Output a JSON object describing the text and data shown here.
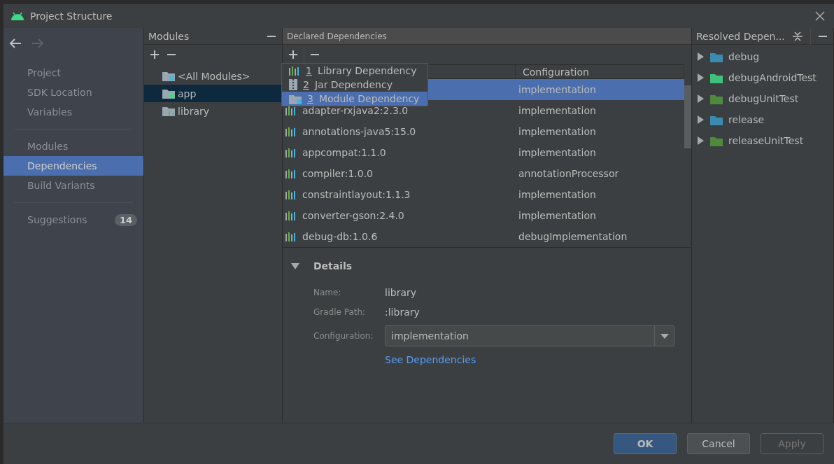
{
  "window": {
    "title": "Project Structure"
  },
  "nav": {
    "back": {
      "disabled": false
    },
    "forward": {
      "disabled": true
    }
  },
  "sidebar": {
    "groups": [
      {
        "items": [
          {
            "label": "Project",
            "selected": false
          },
          {
            "label": "SDK Location",
            "selected": false
          },
          {
            "label": "Variables",
            "selected": false
          }
        ]
      },
      {
        "items": [
          {
            "label": "Modules",
            "selected": false
          },
          {
            "label": "Dependencies",
            "selected": true
          },
          {
            "label": "Build Variants",
            "selected": false
          }
        ]
      },
      {
        "items": [
          {
            "label": "Suggestions",
            "selected": false,
            "badge": "14"
          }
        ]
      }
    ]
  },
  "modules": {
    "title": "Modules",
    "items": [
      {
        "label": "<All Modules>",
        "kind": "all",
        "selected": false
      },
      {
        "label": "app",
        "kind": "app",
        "selected": true
      },
      {
        "label": "library",
        "kind": "library",
        "selected": false
      }
    ]
  },
  "declared": {
    "title": "Declared Dependencies",
    "columns": [
      "Configuration"
    ],
    "add_menu": [
      {
        "key": "1",
        "label": "Library Dependency",
        "kind": "library",
        "selected": false
      },
      {
        "key": "2",
        "label": "Jar Dependency",
        "kind": "jar",
        "selected": false
      },
      {
        "key": "3",
        "label": "Module Dependency",
        "kind": "module",
        "selected": true
      }
    ],
    "rows": [
      {
        "configuration": "implementation",
        "selected": true
      },
      {
        "name": "adapter-rxjava2:2.3.0",
        "configuration": "implementation",
        "selected": false
      },
      {
        "name": "annotations-java5:15.0",
        "configuration": "implementation",
        "selected": false
      },
      {
        "name": "appcompat:1.1.0",
        "configuration": "implementation",
        "selected": false
      },
      {
        "name": "compiler:1.0.0",
        "configuration": "annotationProcessor",
        "selected": false
      },
      {
        "name": "constraintlayout:1.1.3",
        "configuration": "implementation",
        "selected": false
      },
      {
        "name": "converter-gson:2.4.0",
        "configuration": "implementation",
        "selected": false
      },
      {
        "name": "debug-db:1.0.6",
        "configuration": "debugImplementation",
        "selected": false
      }
    ],
    "details": {
      "title": "Details",
      "expanded": true,
      "fields": [
        {
          "label": "Name:",
          "value": "library"
        },
        {
          "label": "Gradle Path:",
          "value": ":library"
        }
      ],
      "configuration": {
        "label": "Configuration:",
        "value": "implementation"
      },
      "link": "See Dependencies"
    }
  },
  "resolved": {
    "title": "Resolved Depen...",
    "items": [
      {
        "label": "debug",
        "color": "#3b8bb0",
        "expanded": false
      },
      {
        "label": "debugAndroidTest",
        "color": "#3ec27b",
        "expanded": false
      },
      {
        "label": "debugUnitTest",
        "color": "#4f8a3c",
        "expanded": false
      },
      {
        "label": "release",
        "color": "#3b8bb0",
        "expanded": false
      },
      {
        "label": "releaseUnitTest",
        "color": "#4f8a3c",
        "expanded": false
      }
    ]
  },
  "buttons": [
    {
      "label": "OK",
      "default": true,
      "disabled": false
    },
    {
      "label": "Cancel",
      "default": false,
      "disabled": false
    },
    {
      "label": "Apply",
      "default": false,
      "disabled": true
    }
  ]
}
